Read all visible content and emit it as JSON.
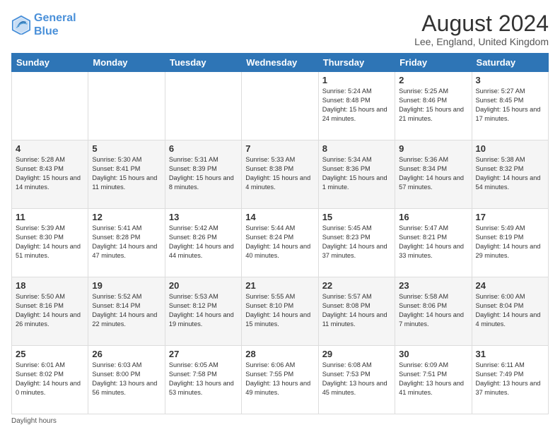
{
  "logo": {
    "line1": "General",
    "line2": "Blue"
  },
  "title": "August 2024",
  "subtitle": "Lee, England, United Kingdom",
  "footer_note": "Daylight hours",
  "days_of_week": [
    "Sunday",
    "Monday",
    "Tuesday",
    "Wednesday",
    "Thursday",
    "Friday",
    "Saturday"
  ],
  "weeks": [
    [
      {
        "day": "",
        "info": ""
      },
      {
        "day": "",
        "info": ""
      },
      {
        "day": "",
        "info": ""
      },
      {
        "day": "",
        "info": ""
      },
      {
        "day": "1",
        "info": "Sunrise: 5:24 AM\nSunset: 8:48 PM\nDaylight: 15 hours\nand 24 minutes."
      },
      {
        "day": "2",
        "info": "Sunrise: 5:25 AM\nSunset: 8:46 PM\nDaylight: 15 hours\nand 21 minutes."
      },
      {
        "day": "3",
        "info": "Sunrise: 5:27 AM\nSunset: 8:45 PM\nDaylight: 15 hours\nand 17 minutes."
      }
    ],
    [
      {
        "day": "4",
        "info": "Sunrise: 5:28 AM\nSunset: 8:43 PM\nDaylight: 15 hours\nand 14 minutes."
      },
      {
        "day": "5",
        "info": "Sunrise: 5:30 AM\nSunset: 8:41 PM\nDaylight: 15 hours\nand 11 minutes."
      },
      {
        "day": "6",
        "info": "Sunrise: 5:31 AM\nSunset: 8:39 PM\nDaylight: 15 hours\nand 8 minutes."
      },
      {
        "day": "7",
        "info": "Sunrise: 5:33 AM\nSunset: 8:38 PM\nDaylight: 15 hours\nand 4 minutes."
      },
      {
        "day": "8",
        "info": "Sunrise: 5:34 AM\nSunset: 8:36 PM\nDaylight: 15 hours\nand 1 minute."
      },
      {
        "day": "9",
        "info": "Sunrise: 5:36 AM\nSunset: 8:34 PM\nDaylight: 14 hours\nand 57 minutes."
      },
      {
        "day": "10",
        "info": "Sunrise: 5:38 AM\nSunset: 8:32 PM\nDaylight: 14 hours\nand 54 minutes."
      }
    ],
    [
      {
        "day": "11",
        "info": "Sunrise: 5:39 AM\nSunset: 8:30 PM\nDaylight: 14 hours\nand 51 minutes."
      },
      {
        "day": "12",
        "info": "Sunrise: 5:41 AM\nSunset: 8:28 PM\nDaylight: 14 hours\nand 47 minutes."
      },
      {
        "day": "13",
        "info": "Sunrise: 5:42 AM\nSunset: 8:26 PM\nDaylight: 14 hours\nand 44 minutes."
      },
      {
        "day": "14",
        "info": "Sunrise: 5:44 AM\nSunset: 8:24 PM\nDaylight: 14 hours\nand 40 minutes."
      },
      {
        "day": "15",
        "info": "Sunrise: 5:45 AM\nSunset: 8:23 PM\nDaylight: 14 hours\nand 37 minutes."
      },
      {
        "day": "16",
        "info": "Sunrise: 5:47 AM\nSunset: 8:21 PM\nDaylight: 14 hours\nand 33 minutes."
      },
      {
        "day": "17",
        "info": "Sunrise: 5:49 AM\nSunset: 8:19 PM\nDaylight: 14 hours\nand 29 minutes."
      }
    ],
    [
      {
        "day": "18",
        "info": "Sunrise: 5:50 AM\nSunset: 8:16 PM\nDaylight: 14 hours\nand 26 minutes."
      },
      {
        "day": "19",
        "info": "Sunrise: 5:52 AM\nSunset: 8:14 PM\nDaylight: 14 hours\nand 22 minutes."
      },
      {
        "day": "20",
        "info": "Sunrise: 5:53 AM\nSunset: 8:12 PM\nDaylight: 14 hours\nand 19 minutes."
      },
      {
        "day": "21",
        "info": "Sunrise: 5:55 AM\nSunset: 8:10 PM\nDaylight: 14 hours\nand 15 minutes."
      },
      {
        "day": "22",
        "info": "Sunrise: 5:57 AM\nSunset: 8:08 PM\nDaylight: 14 hours\nand 11 minutes."
      },
      {
        "day": "23",
        "info": "Sunrise: 5:58 AM\nSunset: 8:06 PM\nDaylight: 14 hours\nand 7 minutes."
      },
      {
        "day": "24",
        "info": "Sunrise: 6:00 AM\nSunset: 8:04 PM\nDaylight: 14 hours\nand 4 minutes."
      }
    ],
    [
      {
        "day": "25",
        "info": "Sunrise: 6:01 AM\nSunset: 8:02 PM\nDaylight: 14 hours\nand 0 minutes."
      },
      {
        "day": "26",
        "info": "Sunrise: 6:03 AM\nSunset: 8:00 PM\nDaylight: 13 hours\nand 56 minutes."
      },
      {
        "day": "27",
        "info": "Sunrise: 6:05 AM\nSunset: 7:58 PM\nDaylight: 13 hours\nand 53 minutes."
      },
      {
        "day": "28",
        "info": "Sunrise: 6:06 AM\nSunset: 7:55 PM\nDaylight: 13 hours\nand 49 minutes."
      },
      {
        "day": "29",
        "info": "Sunrise: 6:08 AM\nSunset: 7:53 PM\nDaylight: 13 hours\nand 45 minutes."
      },
      {
        "day": "30",
        "info": "Sunrise: 6:09 AM\nSunset: 7:51 PM\nDaylight: 13 hours\nand 41 minutes."
      },
      {
        "day": "31",
        "info": "Sunrise: 6:11 AM\nSunset: 7:49 PM\nDaylight: 13 hours\nand 37 minutes."
      }
    ]
  ]
}
